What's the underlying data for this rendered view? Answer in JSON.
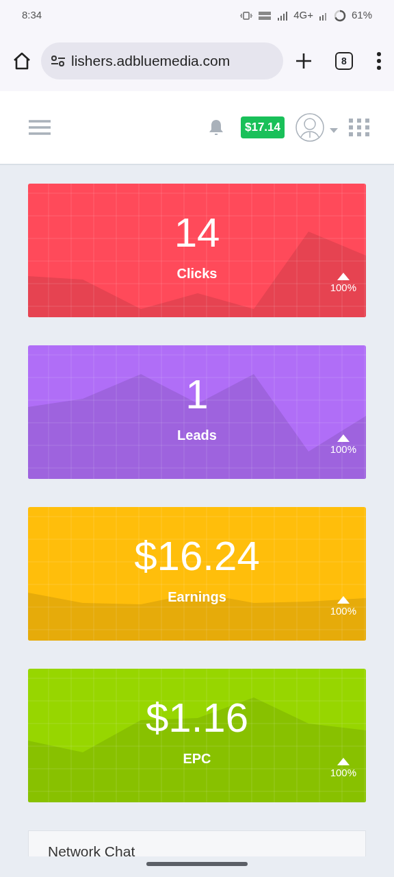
{
  "status_bar": {
    "time": "8:34",
    "network": "4G+",
    "battery": "61%"
  },
  "browser": {
    "url": "lishers.adbluemedia.com",
    "tab_count": "8"
  },
  "header": {
    "balance": "$17.14"
  },
  "stats": [
    {
      "value": "14",
      "label": "Clicks",
      "change": "100%",
      "up": true,
      "color": "#ff4a5a"
    },
    {
      "value": "1",
      "label": "Leads",
      "change": "100%",
      "up": true,
      "color": "#b06ef7"
    },
    {
      "value": "$16.24",
      "label": "Earnings",
      "change": "100%",
      "up": true,
      "color": "#ffbe0b"
    },
    {
      "value": "$1.16",
      "label": "EPC",
      "change": "100%",
      "up": true,
      "color": "#97d600"
    }
  ],
  "chat": {
    "title": "Network Chat"
  }
}
